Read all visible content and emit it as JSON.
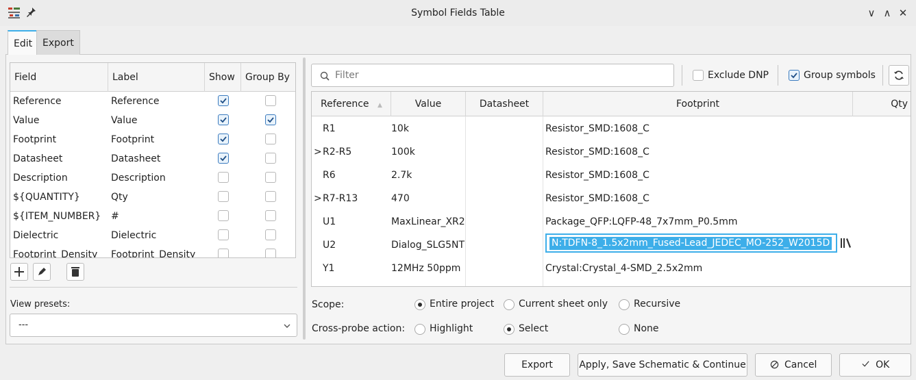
{
  "window": {
    "title": "Symbol Fields Table",
    "controls": [
      "minimize",
      "maximize",
      "close"
    ],
    "minimize_glyph": "∨",
    "maximize_glyph": "∧",
    "close_glyph": "✕"
  },
  "tabs": [
    {
      "label": "Edit",
      "active": true
    },
    {
      "label": "Export",
      "active": false
    }
  ],
  "fields_table": {
    "headers": [
      "Field",
      "Label",
      "Show",
      "Group By"
    ],
    "rows": [
      {
        "field": "Reference",
        "label": "Reference",
        "show": true,
        "group_by": false
      },
      {
        "field": "Value",
        "label": "Value",
        "show": true,
        "group_by": true
      },
      {
        "field": "Footprint",
        "label": "Footprint",
        "show": true,
        "group_by": false
      },
      {
        "field": "Datasheet",
        "label": "Datasheet",
        "show": true,
        "group_by": false
      },
      {
        "field": "Description",
        "label": "Description",
        "show": false,
        "group_by": false
      },
      {
        "field": "${QUANTITY}",
        "label": "Qty",
        "show": false,
        "group_by": false
      },
      {
        "field": "${ITEM_NUMBER}",
        "label": "#",
        "show": false,
        "group_by": false
      },
      {
        "field": "Dielectric",
        "label": "Dielectric",
        "show": false,
        "group_by": false
      },
      {
        "field": "Footprint_Density",
        "label": "Footprint_Density",
        "show": false,
        "group_by": false
      }
    ],
    "buttons": [
      "plus-icon",
      "pencil-icon",
      "trash-icon"
    ]
  },
  "view_presets": {
    "label": "View presets:",
    "value": "---"
  },
  "toolbar": {
    "filter_placeholder": "Filter",
    "exclude_dnp": {
      "label": "Exclude DNP",
      "checked": false
    },
    "group_symbols": {
      "label": "Group symbols",
      "checked": true
    },
    "refresh_icon": "refresh-icon"
  },
  "grid": {
    "headers": [
      "Reference",
      "Value",
      "Datasheet",
      "Footprint",
      "Qty"
    ],
    "sort_indicator": "▲",
    "rows": [
      {
        "expand": "",
        "reference": "R1",
        "value": "10k",
        "datasheet": "",
        "footprint": "Resistor_SMD:1608_C",
        "qty": ""
      },
      {
        "expand": ">",
        "reference": "R2-R5",
        "value": "100k",
        "datasheet": "",
        "footprint": "Resistor_SMD:1608_C",
        "qty": ""
      },
      {
        "expand": "",
        "reference": "R6",
        "value": "2.7k",
        "datasheet": "",
        "footprint": "Resistor_SMD:1608_C",
        "qty": ""
      },
      {
        "expand": ">",
        "reference": "R7-R13",
        "value": "470",
        "datasheet": "",
        "footprint": "Resistor_SMD:1608_C",
        "qty": ""
      },
      {
        "expand": "",
        "reference": "U1",
        "value": "MaxLinear_XR2",
        "datasheet": "",
        "footprint": "Package_QFP:LQFP-48_7x7mm_P0.5mm",
        "qty": ""
      },
      {
        "expand": "",
        "reference": "U2",
        "value": "Dialog_SLG5NT",
        "datasheet": "",
        "footprint": "",
        "qty": ""
      },
      {
        "expand": "",
        "reference": "Y1",
        "value": "12MHz 50ppm",
        "datasheet": "",
        "footprint": "Crystal:Crystal_4-SMD_2.5x2mm",
        "qty": ""
      }
    ],
    "editor_text": "N:TDFN-8_1.5x2mm_Fused-Lead_JEDEC_MO-252_W2015D",
    "library_icon": "library-icon"
  },
  "scope": {
    "label": "Scope:",
    "options": [
      {
        "label": "Entire project",
        "selected": true
      },
      {
        "label": "Current sheet only",
        "selected": false
      },
      {
        "label": "Recursive",
        "selected": false
      }
    ]
  },
  "cross_probe": {
    "label": "Cross-probe action:",
    "options": [
      {
        "label": "Highlight",
        "selected": false
      },
      {
        "label": "Select",
        "selected": true
      },
      {
        "label": "None",
        "selected": false
      }
    ]
  },
  "buttons": {
    "export": "Export",
    "apply": "Apply, Save Schematic & Continue",
    "cancel": "Cancel",
    "ok": "OK"
  },
  "colors": {
    "accent": "#3daee9",
    "checkbox_border": "#3b7bbf"
  }
}
